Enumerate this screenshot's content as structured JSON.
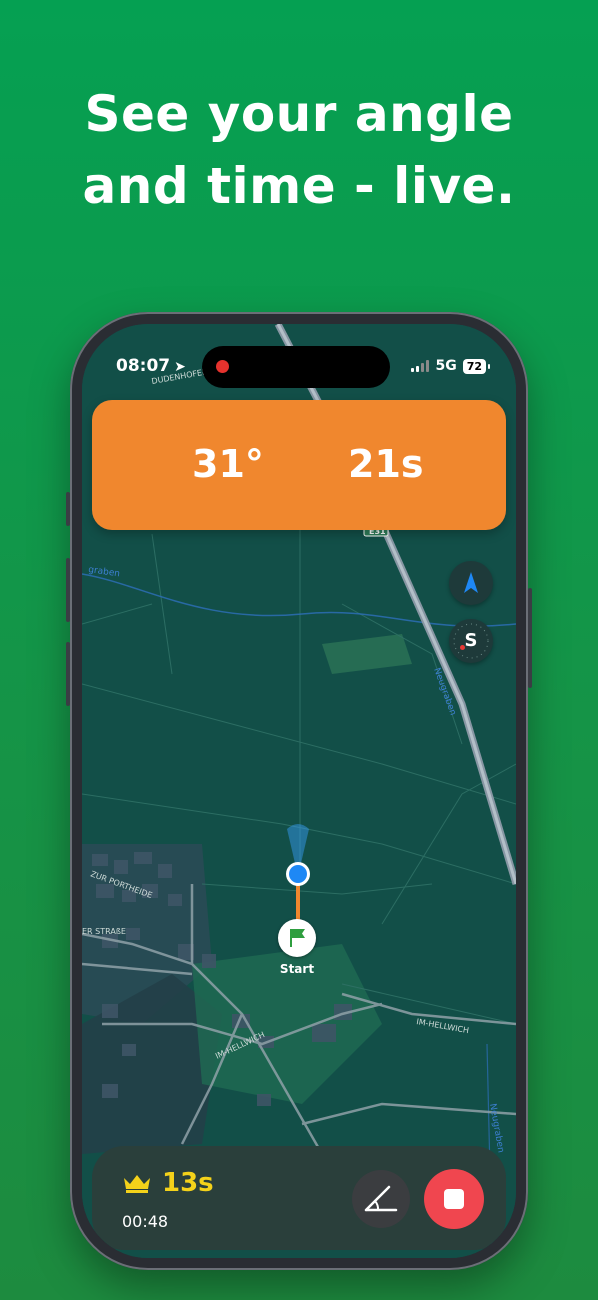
{
  "headline": {
    "line1": "See your angle",
    "line2": "and time - live."
  },
  "status_bar": {
    "time": "08:07",
    "network": "5G",
    "battery": "72"
  },
  "live_readout": {
    "angle": "31°",
    "time": "21s"
  },
  "map": {
    "start_label": "Start",
    "road_labels": [
      "DUDENHOFER ST",
      "ZUR PORTHEIDE",
      "ER STRAßE",
      "IM HELLWICH",
      "IM-HELLWICH",
      "E31"
    ],
    "water_labels": [
      "Neugraben",
      "graben"
    ]
  },
  "bottom_panel": {
    "best_time": "13s",
    "elapsed": "00:48"
  },
  "colors": {
    "background_green": "#05a052",
    "card_orange": "#f0872e",
    "best_yellow": "#f4d21a",
    "stop_red": "#f0464f",
    "location_blue": "#1e88f5"
  }
}
